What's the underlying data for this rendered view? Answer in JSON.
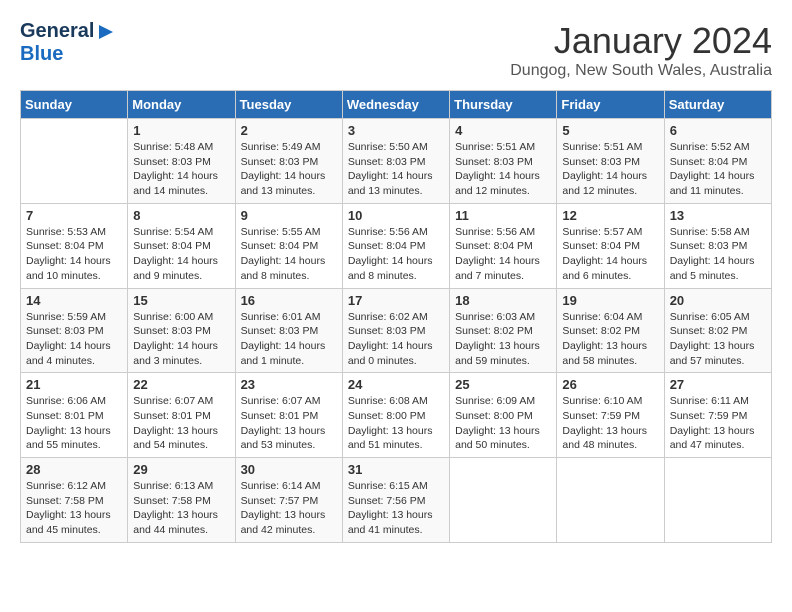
{
  "header": {
    "logo": {
      "general": "General",
      "blue": "Blue"
    },
    "title": "January 2024",
    "subtitle": "Dungog, New South Wales, Australia"
  },
  "days_of_week": [
    "Sunday",
    "Monday",
    "Tuesday",
    "Wednesday",
    "Thursday",
    "Friday",
    "Saturday"
  ],
  "weeks": [
    [
      {
        "day": "",
        "info": ""
      },
      {
        "day": "1",
        "info": "Sunrise: 5:48 AM\nSunset: 8:03 PM\nDaylight: 14 hours\nand 14 minutes."
      },
      {
        "day": "2",
        "info": "Sunrise: 5:49 AM\nSunset: 8:03 PM\nDaylight: 14 hours\nand 13 minutes."
      },
      {
        "day": "3",
        "info": "Sunrise: 5:50 AM\nSunset: 8:03 PM\nDaylight: 14 hours\nand 13 minutes."
      },
      {
        "day": "4",
        "info": "Sunrise: 5:51 AM\nSunset: 8:03 PM\nDaylight: 14 hours\nand 12 minutes."
      },
      {
        "day": "5",
        "info": "Sunrise: 5:51 AM\nSunset: 8:03 PM\nDaylight: 14 hours\nand 12 minutes."
      },
      {
        "day": "6",
        "info": "Sunrise: 5:52 AM\nSunset: 8:04 PM\nDaylight: 14 hours\nand 11 minutes."
      }
    ],
    [
      {
        "day": "7",
        "info": "Sunrise: 5:53 AM\nSunset: 8:04 PM\nDaylight: 14 hours\nand 10 minutes."
      },
      {
        "day": "8",
        "info": "Sunrise: 5:54 AM\nSunset: 8:04 PM\nDaylight: 14 hours\nand 9 minutes."
      },
      {
        "day": "9",
        "info": "Sunrise: 5:55 AM\nSunset: 8:04 PM\nDaylight: 14 hours\nand 8 minutes."
      },
      {
        "day": "10",
        "info": "Sunrise: 5:56 AM\nSunset: 8:04 PM\nDaylight: 14 hours\nand 8 minutes."
      },
      {
        "day": "11",
        "info": "Sunrise: 5:56 AM\nSunset: 8:04 PM\nDaylight: 14 hours\nand 7 minutes."
      },
      {
        "day": "12",
        "info": "Sunrise: 5:57 AM\nSunset: 8:04 PM\nDaylight: 14 hours\nand 6 minutes."
      },
      {
        "day": "13",
        "info": "Sunrise: 5:58 AM\nSunset: 8:03 PM\nDaylight: 14 hours\nand 5 minutes."
      }
    ],
    [
      {
        "day": "14",
        "info": "Sunrise: 5:59 AM\nSunset: 8:03 PM\nDaylight: 14 hours\nand 4 minutes."
      },
      {
        "day": "15",
        "info": "Sunrise: 6:00 AM\nSunset: 8:03 PM\nDaylight: 14 hours\nand 3 minutes."
      },
      {
        "day": "16",
        "info": "Sunrise: 6:01 AM\nSunset: 8:03 PM\nDaylight: 14 hours\nand 1 minute."
      },
      {
        "day": "17",
        "info": "Sunrise: 6:02 AM\nSunset: 8:03 PM\nDaylight: 14 hours\nand 0 minutes."
      },
      {
        "day": "18",
        "info": "Sunrise: 6:03 AM\nSunset: 8:02 PM\nDaylight: 13 hours\nand 59 minutes."
      },
      {
        "day": "19",
        "info": "Sunrise: 6:04 AM\nSunset: 8:02 PM\nDaylight: 13 hours\nand 58 minutes."
      },
      {
        "day": "20",
        "info": "Sunrise: 6:05 AM\nSunset: 8:02 PM\nDaylight: 13 hours\nand 57 minutes."
      }
    ],
    [
      {
        "day": "21",
        "info": "Sunrise: 6:06 AM\nSunset: 8:01 PM\nDaylight: 13 hours\nand 55 minutes."
      },
      {
        "day": "22",
        "info": "Sunrise: 6:07 AM\nSunset: 8:01 PM\nDaylight: 13 hours\nand 54 minutes."
      },
      {
        "day": "23",
        "info": "Sunrise: 6:07 AM\nSunset: 8:01 PM\nDaylight: 13 hours\nand 53 minutes."
      },
      {
        "day": "24",
        "info": "Sunrise: 6:08 AM\nSunset: 8:00 PM\nDaylight: 13 hours\nand 51 minutes."
      },
      {
        "day": "25",
        "info": "Sunrise: 6:09 AM\nSunset: 8:00 PM\nDaylight: 13 hours\nand 50 minutes."
      },
      {
        "day": "26",
        "info": "Sunrise: 6:10 AM\nSunset: 7:59 PM\nDaylight: 13 hours\nand 48 minutes."
      },
      {
        "day": "27",
        "info": "Sunrise: 6:11 AM\nSunset: 7:59 PM\nDaylight: 13 hours\nand 47 minutes."
      }
    ],
    [
      {
        "day": "28",
        "info": "Sunrise: 6:12 AM\nSunset: 7:58 PM\nDaylight: 13 hours\nand 45 minutes."
      },
      {
        "day": "29",
        "info": "Sunrise: 6:13 AM\nSunset: 7:58 PM\nDaylight: 13 hours\nand 44 minutes."
      },
      {
        "day": "30",
        "info": "Sunrise: 6:14 AM\nSunset: 7:57 PM\nDaylight: 13 hours\nand 42 minutes."
      },
      {
        "day": "31",
        "info": "Sunrise: 6:15 AM\nSunset: 7:56 PM\nDaylight: 13 hours\nand 41 minutes."
      },
      {
        "day": "",
        "info": ""
      },
      {
        "day": "",
        "info": ""
      },
      {
        "day": "",
        "info": ""
      }
    ]
  ]
}
